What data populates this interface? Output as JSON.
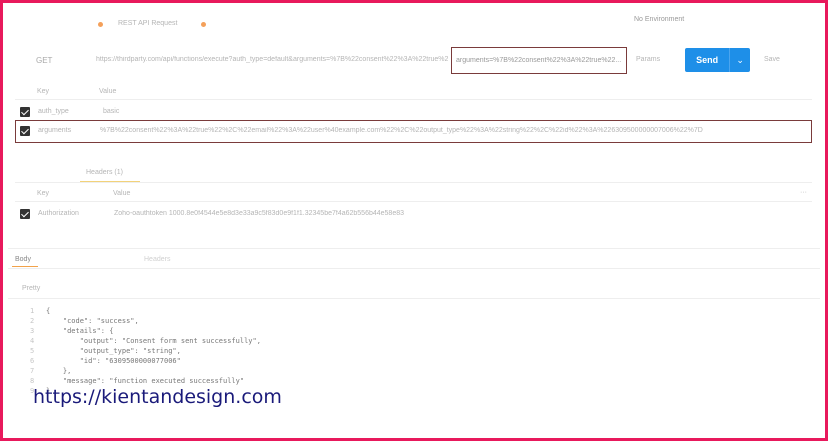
{
  "top": {
    "tab_label": "REST API Request",
    "env_label": "No Environment"
  },
  "request": {
    "method": "GET",
    "url": "https://thirdparty.com/api/functions/execute?auth_type=default&arguments=%7B%22consent%22%3A%22true%22...",
    "url_highlight": "arguments=%7B%22consent%22%3A%22true%22...",
    "params_label": "Params",
    "send_label": "Send",
    "send_dropdown_icon": "chevron-down-icon",
    "save_label": "Save"
  },
  "params": {
    "headers": {
      "key": "Key",
      "value": "Value"
    },
    "rows": [
      {
        "checked": true,
        "key": "auth_type",
        "value": "basic"
      },
      {
        "checked": true,
        "key": "arguments",
        "value": "%7B%22consent%22%3A%22true%22%2C%22email%22%3A%22user%40example.com%22%2C%22output_type%22%3A%22string%22%2C%22id%22%3A%226309500000007006%22%7D"
      }
    ]
  },
  "headers_section": {
    "tab_label": "Headers (1)",
    "key_header": "Key",
    "value_header": "Value",
    "rows": [
      {
        "checked": true,
        "key": "Authorization",
        "value": "Zoho-oauthtoken 1000.8e0f4544e5e8d3e33a9c5f83d0e9f1f1.32345be7f4a62b556b44e58e83"
      }
    ]
  },
  "response": {
    "body_tab": "Body",
    "other_tab": "Headers",
    "view_label": "Pretty",
    "code": "{\n    \"code\": \"success\",\n    \"details\": {\n        \"output\": \"Consent form sent successfully\",\n        \"output_type\": \"string\",\n        \"id\": \"6309500000077006\"\n    },\n    \"message\": \"function executed successfully\"\n}",
    "line_numbers": "1\n2\n3\n4\n5\n6\n7\n8\n9"
  },
  "watermark": "https://kientandesign.com",
  "colors": {
    "frame": "#e8195c",
    "send": "#1e8fe8",
    "accent_dot": "#f4a05a",
    "watermark": "#1a1a7a"
  }
}
